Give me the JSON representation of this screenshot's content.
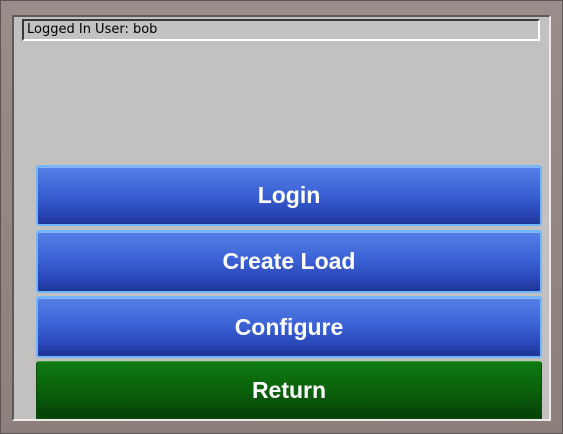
{
  "status": {
    "logged_in_text": "Logged In User: bob"
  },
  "buttons": {
    "login": "Login",
    "create_load": "Create Load",
    "configure": "Configure",
    "return": "Return"
  },
  "colors": {
    "frame": "#8d807c",
    "panel": "#c3c0c0",
    "button_blue": "#3c63d6",
    "button_blue_border": "#6fb6ff",
    "button_green": "#0a5f0b",
    "text": "#ffffff"
  }
}
